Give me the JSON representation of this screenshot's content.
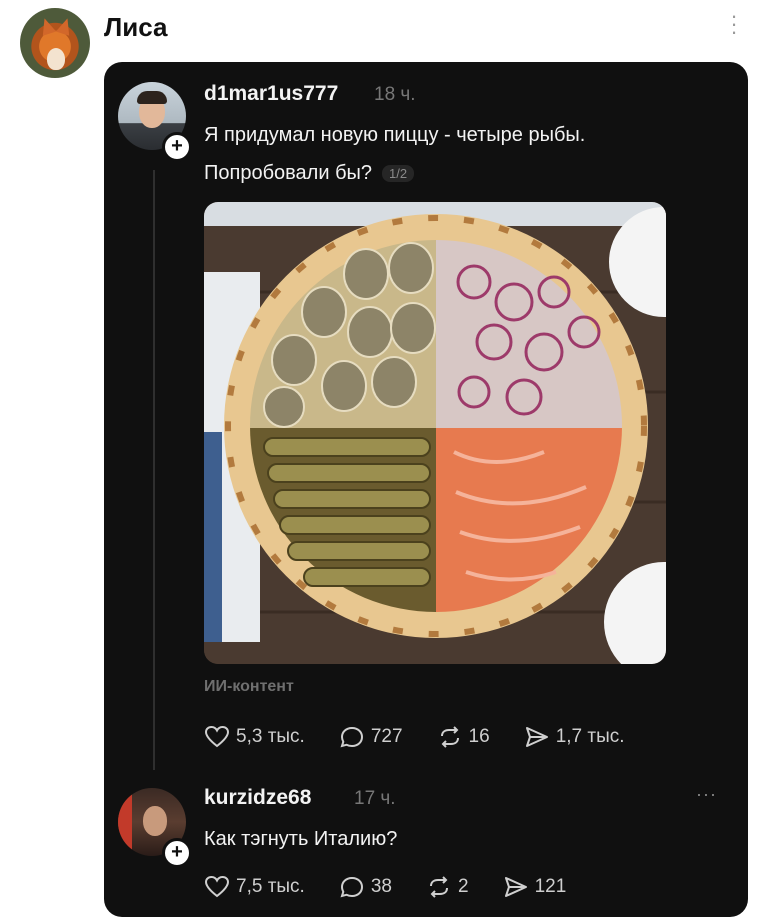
{
  "header": {
    "name": "Лиса"
  },
  "post": {
    "username": "d1mar1us777",
    "time": "18 ч.",
    "text_line1": "Я придумал новую пиццу - четыре рыбы.",
    "text_line2": "Попробовали бы?",
    "page_indicator": "1/2",
    "ai_label": "ИИ-контент",
    "stats": {
      "likes": "5,3 тыс.",
      "comments": "727",
      "reposts": "16",
      "shares": "1,7 тыс."
    }
  },
  "reply": {
    "username": "kurzidze68",
    "time": "17 ч.",
    "more": "···",
    "text": "Как тэгнуть Италию?",
    "stats": {
      "likes": "7,5 тыс.",
      "comments": "38",
      "reposts": "2",
      "shares": "121"
    }
  },
  "icons": [
    "heart-icon",
    "comment-icon",
    "repost-icon",
    "share-icon",
    "more-icon",
    "plus-icon"
  ]
}
